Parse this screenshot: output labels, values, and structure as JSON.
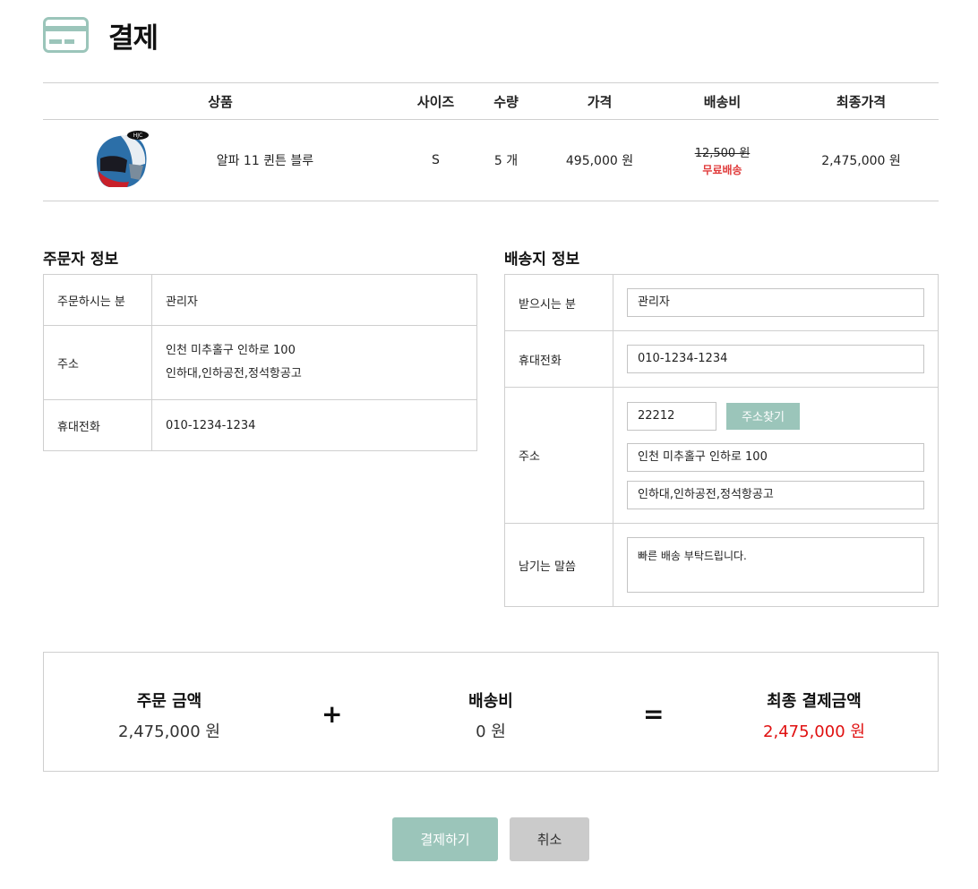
{
  "header": {
    "title": "결제",
    "icon": "credit-card-icon",
    "accent": "#9bc5ba"
  },
  "cart": {
    "columns": [
      "상품",
      "사이즈",
      "수량",
      "가격",
      "배송비",
      "최종가격"
    ],
    "item": {
      "image": "helmet-image",
      "name": "알파 11 퀸튼 블루",
      "size": "S",
      "quantity": "5 개",
      "price": "495,000 원",
      "shipping_original": "12,500 원",
      "shipping_note": "무료배송",
      "final_price": "2,475,000 원"
    }
  },
  "orderer": {
    "title": "주문자 정보",
    "rows": [
      {
        "label": "주문하시는 분",
        "value": "관리자"
      },
      {
        "label": "주소",
        "value": "인천 미추홀구 인하로 100",
        "value2": "인하대,인하공전,정석항공고"
      },
      {
        "label": "휴대전화",
        "value": "010-1234-1234"
      }
    ]
  },
  "shipping": {
    "title": "배송지 정보",
    "recipient_label": "받으시는 분",
    "recipient_value": "관리자",
    "phone_label": "휴대전화",
    "phone_value": "010-1234-1234",
    "address_label": "주소",
    "zip_value": "22212",
    "find_button": "주소찾기",
    "address1": "인천 미추홀구 인하로 100",
    "address2": "인하대,인하공전,정석항공고",
    "message_label": "남기는 말씀",
    "message_value": "빠른 배송 부탁드립니다."
  },
  "summary": {
    "order_label": "주문 금액",
    "order_value": "2,475,000 원",
    "plus": "+",
    "shipping_label": "배송비",
    "shipping_value": "0 원",
    "equals": "=",
    "final_label": "최종 결제금액",
    "final_value": "2,475,000 원",
    "final_color": "#e01010"
  },
  "buttons": {
    "pay": "결제하기",
    "cancel": "취소"
  }
}
